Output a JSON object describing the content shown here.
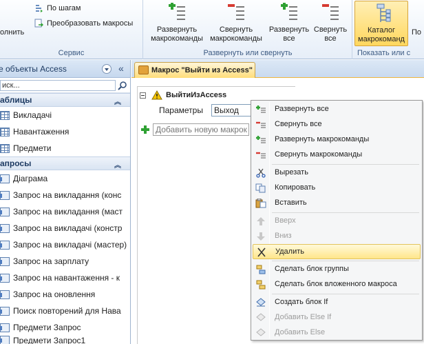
{
  "ribbon": {
    "small_buttons": [
      {
        "label": "По шагам",
        "icon": "step-icon"
      },
      {
        "label": "Преобразовать макросы",
        "icon": "convert-macro-icon"
      }
    ],
    "run_fragment": "олнить",
    "group_service": "Сервис",
    "expand_actions": "Развернуть макрокоманды",
    "collapse_actions": "Свернуть макрокоманды",
    "expand_all": "Развернуть все",
    "collapse_all": "Свернуть все",
    "group_expand_collapse": "Развернуть или свернуть",
    "action_catalog": "Каталог макрокоманд",
    "next_fragment": "По",
    "group_show_hide": "Показать или с"
  },
  "nav": {
    "title": "е объекты Access",
    "search_value": "иск...",
    "sections": [
      {
        "label": "аблицы",
        "items": [
          "Викладачі",
          "Навантаження",
          "Предмети"
        ]
      },
      {
        "label": "апросы",
        "items": [
          "Діаграма",
          "Запрос на викладання (конс",
          "Запрос на викладання (маст",
          "Запрос на викладачі (констр",
          "Запрос на викладачі (мастер)",
          "Запрос на зарплату",
          "Запрос на навантаження - к",
          "Запрос на оновлення",
          "Поиск повторений для Нава",
          "Предмети Запрос",
          "Предмети Запрос1"
        ]
      }
    ]
  },
  "doc": {
    "tab_title": "Макрос \"Выйти из Access\"",
    "macro_name": "ВыйтиИзAccess",
    "param_label": "Параметры",
    "param_value": "Выход",
    "add_placeholder": "Добавить новую макрок"
  },
  "context_menu": {
    "items": [
      {
        "label": "Развернуть все",
        "icon": "expand-all-icon",
        "disabled": false
      },
      {
        "label": "Свернуть все",
        "icon": "collapse-all-icon",
        "disabled": false
      },
      {
        "label": "Развернуть макрокоманды",
        "icon": "expand-actions-icon",
        "disabled": false
      },
      {
        "label": "Свернуть макрокоманды",
        "icon": "collapse-actions-icon",
        "disabled": false
      },
      {
        "label": "Вырезать",
        "icon": "scissors-icon",
        "disabled": false
      },
      {
        "label": "Копировать",
        "icon": "copy-icon",
        "disabled": false
      },
      {
        "label": "Вставить",
        "icon": "paste-icon",
        "disabled": false
      },
      {
        "label": "Вверх",
        "icon": "arrow-up-icon",
        "disabled": true
      },
      {
        "label": "Вниз",
        "icon": "arrow-down-icon",
        "disabled": true
      },
      {
        "label": "Удалить",
        "icon": "delete-x-icon",
        "disabled": false,
        "highlighted": true
      },
      {
        "label": "Сделать блок группы",
        "icon": "group-block-icon",
        "disabled": false
      },
      {
        "label": "Сделать блок вложенного макроса",
        "icon": "submacro-block-icon",
        "disabled": false
      },
      {
        "label": "Создать блок If",
        "icon": "if-block-icon",
        "disabled": false
      },
      {
        "label": "Добавить Else If",
        "icon": "else-if-icon",
        "disabled": true
      },
      {
        "label": "Добавить Else",
        "icon": "else-icon",
        "disabled": true
      }
    ]
  },
  "colors": {
    "accent": "#ffd75e",
    "ribbon_blue": "#3c5a82",
    "green_plus": "#2fa133",
    "red_minus": "#d63a32"
  }
}
